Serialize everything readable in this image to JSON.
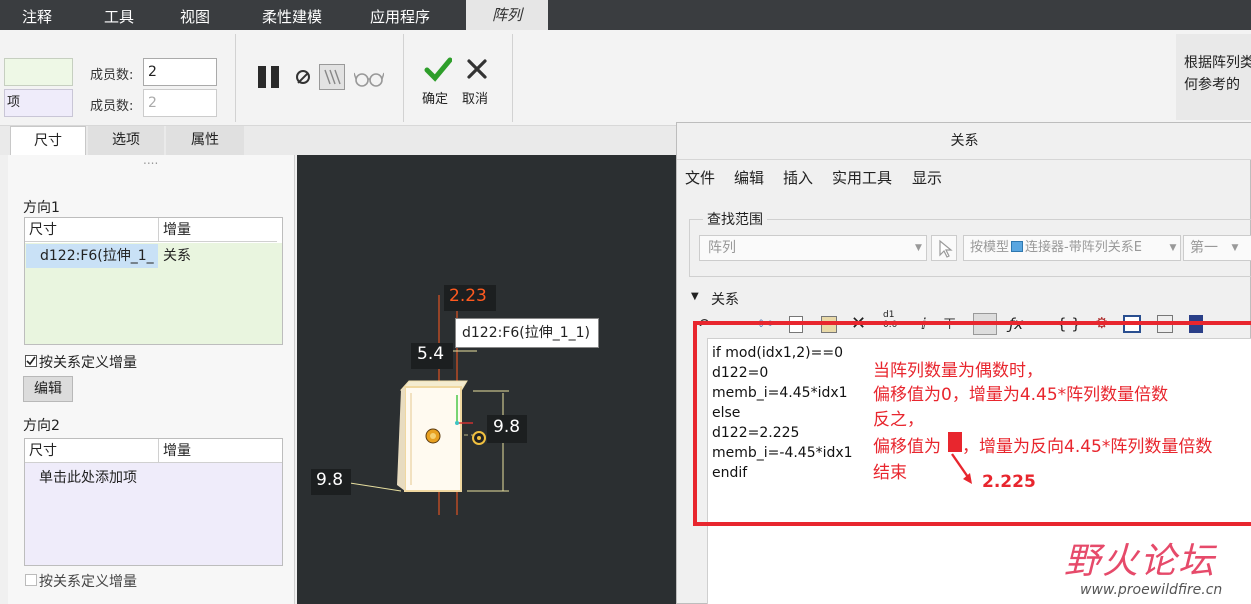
{
  "menubar": {
    "items": [
      "注释",
      "工具",
      "视图",
      "柔性建模",
      "应用程序"
    ],
    "active_tab": "阵列"
  },
  "ribbon": {
    "purple_field_text": "项",
    "member_count_label_1": "成员数:",
    "member_count_value_1": "2",
    "member_count_label_2": "成员数:",
    "member_count_placeholder_2": "2",
    "confirm_label": "确定",
    "cancel_label": "取消",
    "help_line_1": "根据阵列类",
    "help_line_2": "何参考的"
  },
  "tabs": [
    "尺寸",
    "选项",
    "属性"
  ],
  "left_panel": {
    "handle": "....",
    "dir1_title": "方向1",
    "dir1_headers": [
      "尺寸",
      "增量"
    ],
    "dir1_row": {
      "dim": "d122:F6(拉伸_1_",
      "increment": "关系"
    },
    "dir1_checkbox_label": "按关系定义增量",
    "edit_label": "编辑",
    "dir2_title": "方向2",
    "dir2_headers": [
      "尺寸",
      "增量"
    ],
    "dir2_row": "单击此处添加项",
    "dir2_checkbox_label": "按关系定义增量"
  },
  "viewport": {
    "dim_top": "2.23",
    "dim_left": "5.4",
    "dim_right": "9.8",
    "dim_bottom": "9.8",
    "tooltip": "d122:F6(拉伸_1_1)"
  },
  "dialog": {
    "title": "关系",
    "menu": [
      "文件",
      "编辑",
      "插入",
      "实用工具",
      "显示"
    ],
    "find_scope_label": "查找范围",
    "scope_value": "阵列",
    "model_value": "按模型",
    "model_name": "连接器-带阵列关系E",
    "first_value": "第一",
    "relations_label": "关系",
    "code": [
      "if  mod(idx1,2)==0",
      " d122=0",
      " memb_i=4.45*idx1",
      "else",
      " d122=2.225",
      " memb_i=-4.45*idx1",
      "endif"
    ]
  },
  "annotations": {
    "line1": "当阵列数量为偶数时，",
    "line2": "偏移值为0，增量为4.45*阵列数量倍数",
    "line3": "反之，",
    "line4a": "偏移值为",
    "line4b": "，增量为反向4.45*阵列数量倍数",
    "line5": "结束",
    "arrow_value": "2.225"
  },
  "watermark": {
    "title": "野火论坛",
    "url": "www.proewildfire.cn"
  },
  "colors": {
    "menubar": "#3a3d40",
    "annotation_red": "#e8262e",
    "viewport": "#2b2f31",
    "dim_orange": "#ff5a1f"
  }
}
